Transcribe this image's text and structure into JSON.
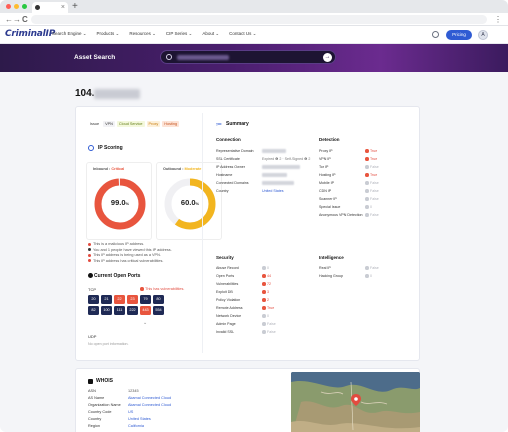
{
  "browser": {
    "tab_close": "×",
    "new_tab": "+",
    "back_glyph": "←",
    "forward_glyph": "→",
    "reload_glyph": "C",
    "menu_glyph": "⋮"
  },
  "nav": {
    "logo": "CriminalIP",
    "links": [
      "Search Engine ⌄",
      "Products ⌄",
      "Resources ⌄",
      "CIP Series ⌄",
      "About ⌄",
      "Contact Us ⌄"
    ],
    "pricing": "Pricing",
    "avatar": "A"
  },
  "hero": {
    "title": "Asset Search",
    "search_go": "→"
  },
  "ip_title": "104.",
  "tags": [
    {
      "label": "Issue",
      "bg": "#ffffff",
      "fg": "#333333"
    },
    {
      "label": "VPN",
      "bg": "#f2f2f5",
      "fg": "#333333"
    },
    {
      "label": "Cloud Service",
      "bg": "#f4f8dc",
      "fg": "#5f7a12"
    },
    {
      "label": "Proxy",
      "bg": "#fdf0d9",
      "fg": "#c77a0c"
    },
    {
      "label": "Hosting",
      "bg": "#fde3d6",
      "fg": "#c4541f"
    }
  ],
  "scoring": {
    "title": "IP Scoring",
    "inbound_label": "Inbound :",
    "inbound_level": "Critical",
    "inbound_value": "99.0",
    "inbound_fraction": 0.99,
    "inbound_color": "#e8553e",
    "outbound_label": "Outbound :",
    "outbound_level": "Moderate",
    "outbound_value": "60.0",
    "outbound_fraction": 0.6,
    "outbound_color": "#f2b51f",
    "unit": "%"
  },
  "alerts": [
    {
      "text": "This is a malicious IP address.",
      "color": "#e24b3f"
    },
    {
      "text": "You and 1 people have viewed this IP address.",
      "color": "#333333"
    },
    {
      "text": "This IP address is being used as a VPN.",
      "color": "#e24b3f"
    },
    {
      "text": "This IP address has critical vulnerabilities.",
      "color": "#e24b3f"
    }
  ],
  "ports": {
    "title": "Current Open Ports",
    "tcp_label": "TCP",
    "tcp_note": "This has vulnerabilities.",
    "tcp": [
      {
        "port": "20",
        "red": false
      },
      {
        "port": "21",
        "red": false
      },
      {
        "port": "22",
        "red": true
      },
      {
        "port": "23",
        "red": true
      },
      {
        "port": "79",
        "red": false
      },
      {
        "port": "80",
        "red": false
      },
      {
        "port": "82",
        "red": false
      },
      {
        "port": "100",
        "red": false
      },
      {
        "port": "111",
        "red": false
      },
      {
        "port": "222",
        "red": false
      },
      {
        "port": "443",
        "red": true
      },
      {
        "port": "554",
        "red": false
      }
    ],
    "chevron": "⌄",
    "udp_label": "UDP",
    "udp_empty": "No open port information."
  },
  "summary": {
    "title": "Summary",
    "connection": {
      "title": "Connection",
      "rows": [
        {
          "k": "Representative Domain",
          "v": "",
          "kind": "blur"
        },
        {
          "k": "SSL Certificate",
          "v": "Expired ❶ 2 · Self-Signed ❶ 2",
          "kind": "plain"
        },
        {
          "k": "IP Address Owner",
          "v": "",
          "kind": "blur"
        },
        {
          "k": "Hostname",
          "v": "",
          "kind": "blur"
        },
        {
          "k": "Connected Domains",
          "v": "",
          "kind": "blur"
        },
        {
          "k": "Country",
          "v": "United States",
          "kind": "blue"
        }
      ]
    },
    "detection": {
      "title": "Detection",
      "rows": [
        {
          "k": "Proxy IP",
          "v": "True",
          "kind": "red"
        },
        {
          "k": "VPN IP",
          "v": "True",
          "kind": "red"
        },
        {
          "k": "Tor IP",
          "v": "False",
          "kind": "gray"
        },
        {
          "k": "Hosting IP",
          "v": "True",
          "kind": "red"
        },
        {
          "k": "Mobile IP",
          "v": "False",
          "kind": "gray"
        },
        {
          "k": "CDN IP",
          "v": "False",
          "kind": "gray"
        },
        {
          "k": "Scanner IP",
          "v": "False",
          "kind": "gray"
        },
        {
          "k": "Special Issue",
          "v": "0",
          "kind": "gray"
        },
        {
          "k": "Anonymous VPN Detection",
          "v": "False",
          "kind": "gray"
        }
      ]
    },
    "security": {
      "title": "Security",
      "rows": [
        {
          "k": "Abuse Record",
          "v": "0",
          "kind": "gray"
        },
        {
          "k": "Open Ports",
          "v": "44",
          "kind": "red"
        },
        {
          "k": "Vulnerabilities",
          "v": "72",
          "kind": "red"
        },
        {
          "k": "Exploit DB",
          "v": "3",
          "kind": "red"
        },
        {
          "k": "Policy Violation",
          "v": "2",
          "kind": "red"
        },
        {
          "k": "Remote Address",
          "v": "True",
          "kind": "red"
        },
        {
          "k": "Network Device",
          "v": "0",
          "kind": "gray"
        },
        {
          "k": "Admin Page",
          "v": "False",
          "kind": "gray"
        },
        {
          "k": "Invalid SSL",
          "v": "False",
          "kind": "gray"
        }
      ]
    },
    "intelligence": {
      "title": "Intelligence",
      "rows": [
        {
          "k": "Real IP",
          "v": "False",
          "kind": "gray"
        },
        {
          "k": "Hacking Group",
          "v": "0",
          "kind": "gray"
        }
      ]
    }
  },
  "whois": {
    "title": "WHOIS",
    "rows": [
      {
        "k": "ASN",
        "v": "12345",
        "kind": "plain"
      },
      {
        "k": "AS Name",
        "v": "Akamai Connected Cloud",
        "kind": "blue"
      },
      {
        "k": "Organization Name",
        "v": "Akamai Connected Cloud",
        "kind": "blue"
      },
      {
        "k": "Country Code",
        "v": "US",
        "kind": "blue"
      },
      {
        "k": "Country",
        "v": "United States",
        "kind": "blue"
      },
      {
        "k": "Region",
        "v": "California",
        "kind": "blue"
      }
    ]
  }
}
